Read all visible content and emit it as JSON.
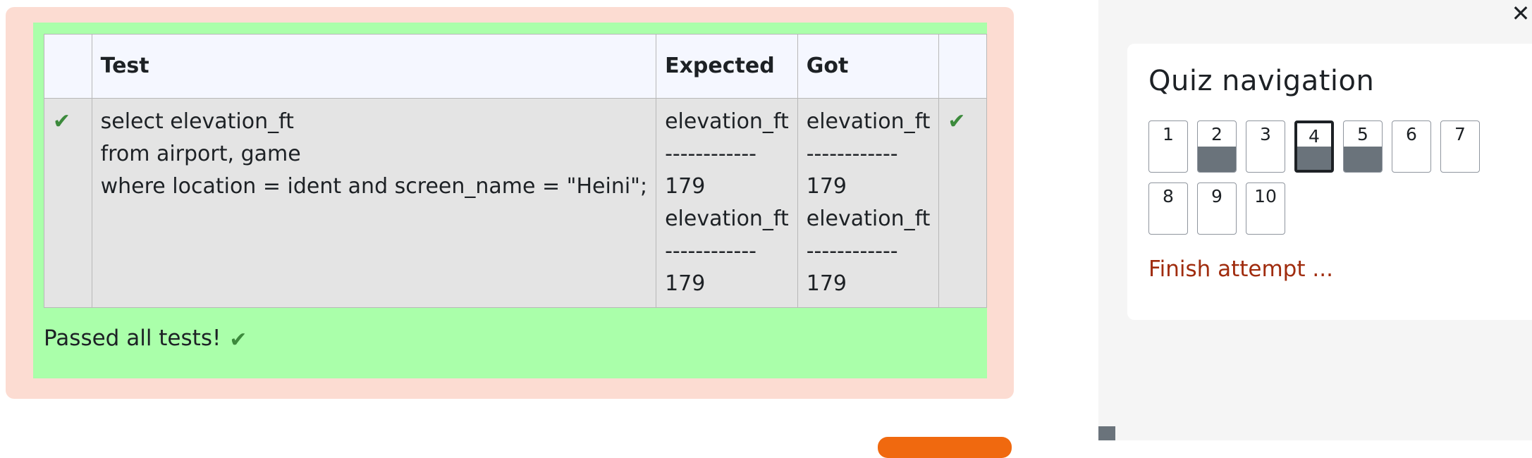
{
  "results": {
    "headers": {
      "icon": "",
      "test": "Test",
      "expected": "Expected",
      "got": "Got",
      "icon2": ""
    },
    "rows": [
      {
        "status_icon": "check-icon",
        "test": "select elevation_ft\nfrom airport, game\nwhere location = ident and screen_name = \"Heini\";",
        "expected": "elevation_ft\n------------\n179\nelevation_ft\n------------\n179",
        "got": "elevation_ft\n------------\n179\nelevation_ft\n------------\n179",
        "result_icon": "check-icon"
      }
    ],
    "summary": "Passed all tests!",
    "summary_icon": "check-icon"
  },
  "quiz_nav": {
    "close_icon": "close-icon",
    "title": "Quiz navigation",
    "questions": [
      {
        "label": "1",
        "state": "empty"
      },
      {
        "label": "2",
        "state": "answered"
      },
      {
        "label": "3",
        "state": "empty"
      },
      {
        "label": "4",
        "state": "answered",
        "current": true
      },
      {
        "label": "5",
        "state": "answered"
      },
      {
        "label": "6",
        "state": "empty"
      },
      {
        "label": "7",
        "state": "empty"
      },
      {
        "label": "8",
        "state": "empty"
      },
      {
        "label": "9",
        "state": "empty"
      },
      {
        "label": "10",
        "state": "empty"
      }
    ],
    "finish_label": "Finish attempt ..."
  },
  "colors": {
    "outcome_bg": "#fcdcd2",
    "passed_bg": "#aaffaa",
    "check": "#3c8a3c",
    "finish_link": "#a02c0e",
    "answered_fill": "#6a737b"
  }
}
